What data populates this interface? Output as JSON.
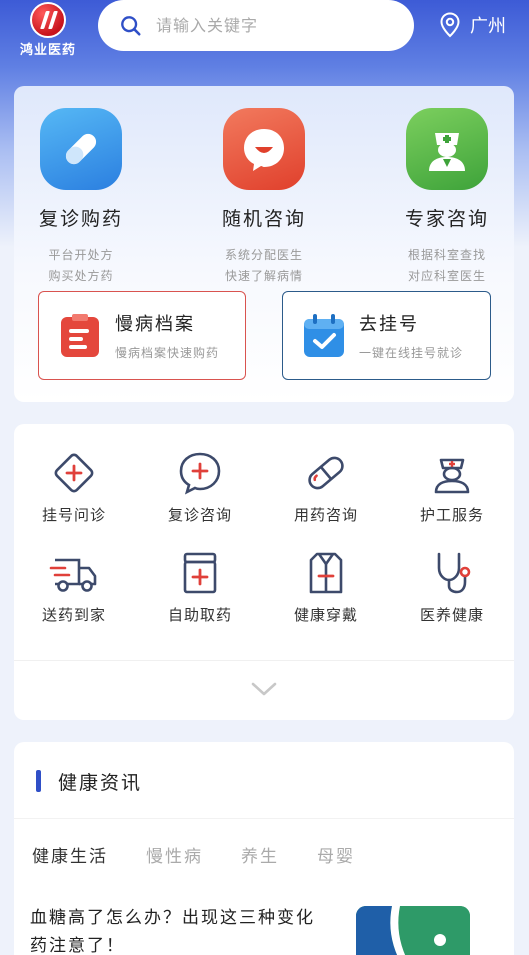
{
  "header": {
    "logo_text": "鸿业医药",
    "search_placeholder": "请输入关键字",
    "location": "广州"
  },
  "services": [
    {
      "title": "复诊购药",
      "sub1": "平台开处方",
      "sub2": "购买处方药",
      "icon": "pill-icon"
    },
    {
      "title": "随机咨询",
      "sub1": "系统分配医生",
      "sub2": "快速了解病情",
      "icon": "chat-bubble-icon"
    },
    {
      "title": "专家咨询",
      "sub1": "根据科室查找",
      "sub2": "对应科室医生",
      "icon": "doctor-icon"
    }
  ],
  "quick_boxes": [
    {
      "title": "慢病档案",
      "sub": "慢病档案快速购药",
      "icon": "clipboard-icon"
    },
    {
      "title": "去挂号",
      "sub": "一键在线挂号就诊",
      "icon": "calendar-check-icon"
    }
  ],
  "grid": [
    {
      "label": "挂号问诊",
      "icon": "diamond-plus-icon"
    },
    {
      "label": "复诊咨询",
      "icon": "chat-plus-icon"
    },
    {
      "label": "用药咨询",
      "icon": "capsule-icon"
    },
    {
      "label": "护工服务",
      "icon": "nurse-icon"
    },
    {
      "label": "送药到家",
      "icon": "truck-icon"
    },
    {
      "label": "自助取药",
      "icon": "medicine-box-icon"
    },
    {
      "label": "健康穿戴",
      "icon": "wearable-icon"
    },
    {
      "label": "医养健康",
      "icon": "stethoscope-icon"
    }
  ],
  "news": {
    "title": "健康资讯",
    "tabs": [
      "健康生活",
      "慢性病",
      "养生",
      "母婴"
    ],
    "article_title": "血糖高了怎么办？出现这三种变化药注意了！"
  }
}
